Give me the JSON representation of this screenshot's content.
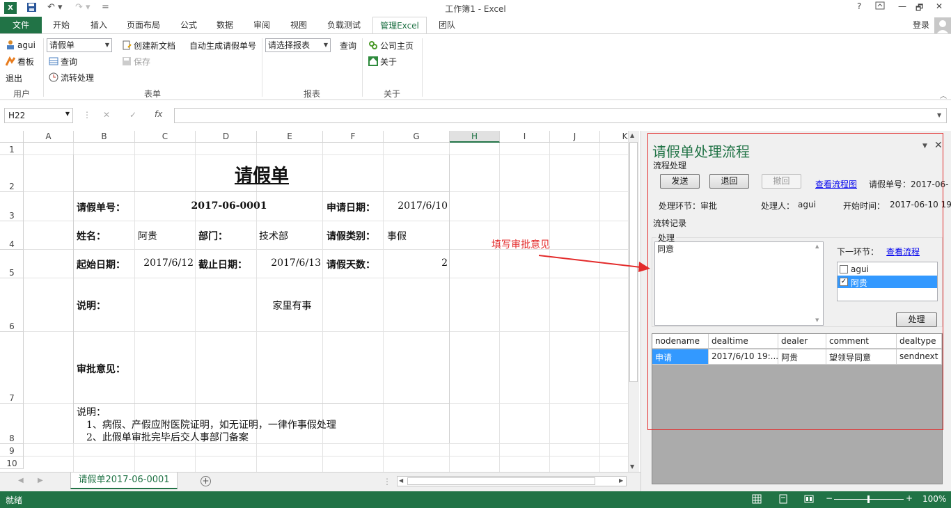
{
  "window": {
    "title": "工作簿1 - Excel",
    "help": "?",
    "restore": "🗗",
    "minimize": "—",
    "maximize": "🗖",
    "close": "✕"
  },
  "qat": {
    "save_icon": "save-icon",
    "undo_icon": "undo-icon",
    "redo_icon": "redo-icon",
    "customize": "="
  },
  "tabs": [
    "文件",
    "开始",
    "插入",
    "页面布局",
    "公式",
    "数据",
    "审阅",
    "视图",
    "负载测试",
    "管理Excel",
    "团队"
  ],
  "login": "登录",
  "ribbon": {
    "user_group": {
      "user": "agui",
      "dashboard": "看板",
      "logout": "退出",
      "label": "用户"
    },
    "form_group": {
      "form_combo": "请假单",
      "query": "查询",
      "flow": "流转处理",
      "create_doc": "创建新文档",
      "save": "保存",
      "auto_gen": "自动生成请假单号",
      "label": "表单"
    },
    "report_group": {
      "report_combo": "请选择报表",
      "query": "查询",
      "label": "报表"
    },
    "about_group": {
      "homepage": "公司主页",
      "about": "关于",
      "label": "关于"
    }
  },
  "formula_bar": {
    "namebox": "H22",
    "cancel": "✕",
    "enter": "✓",
    "fx": "fx",
    "value": ""
  },
  "sheet": {
    "columns": [
      "A",
      "B",
      "C",
      "D",
      "E",
      "F",
      "G",
      "H",
      "I",
      "J",
      "K"
    ],
    "rows": [
      "1",
      "2",
      "3",
      "4",
      "5",
      "6",
      "7",
      "8",
      "9",
      "10"
    ],
    "form_title": "请假单",
    "leave_no_label": "请假单号：",
    "leave_no": "2017-06-0001",
    "apply_date_label": "申请日期：",
    "apply_date": "2017/6/10",
    "name_label": "姓名：",
    "name": "阿贵",
    "dept_label": "部门：",
    "dept": "技术部",
    "type_label": "请假类别：",
    "type": "事假",
    "start_label": "起始日期：",
    "start": "2017/6/12",
    "end_label": "截止日期：",
    "end": "2017/6/13",
    "days_label": "请假天数：",
    "days": "2",
    "reason_label": "说明：",
    "reason": "家里有事",
    "approval_label": "审批意见：",
    "notes": [
      "说明：",
      "1、病假、产假应附医院证明，如无证明，一律作事假处理",
      "2、此假单审批完毕后交人事部门备案"
    ]
  },
  "sheet_tab": "请假单2017-06-0001",
  "status": {
    "ready": "就绪",
    "zoom": "100%",
    "minus": "−",
    "plus": "+"
  },
  "annotation": "填写审批意见",
  "pane": {
    "title": "请假单处理流程",
    "section": "流程处理",
    "send": "发送",
    "back": "退回",
    "withdraw": "撤回",
    "view_chart": "查看流程图",
    "doc_no": "请假单号：2017-06-",
    "node_label": "处理环节：审批",
    "handler_label": "处理人：",
    "handler": "agui",
    "start_label": "开始时间：",
    "start_time": "2017-06-10 19",
    "records_label": "流转记录",
    "process_legend": "处理",
    "comment": "同意",
    "next_label": "下一环节：",
    "view_flow": "查看流程",
    "next_options": [
      {
        "label": "agui",
        "checked": false
      },
      {
        "label": "阿贵",
        "checked": true
      }
    ],
    "process_btn": "处理",
    "grid_headers": [
      "nodename",
      "dealtime",
      "dealer",
      "comment",
      "dealtype"
    ],
    "grid_rows": [
      [
        "申请",
        "2017/6/10 19:...",
        "阿贵",
        "望领导同意",
        "sendnext"
      ]
    ]
  },
  "colors": {
    "excel_green": "#217346",
    "accent_red": "#e32b2b",
    "link": "#0000ee",
    "selection": "#3399ff"
  }
}
